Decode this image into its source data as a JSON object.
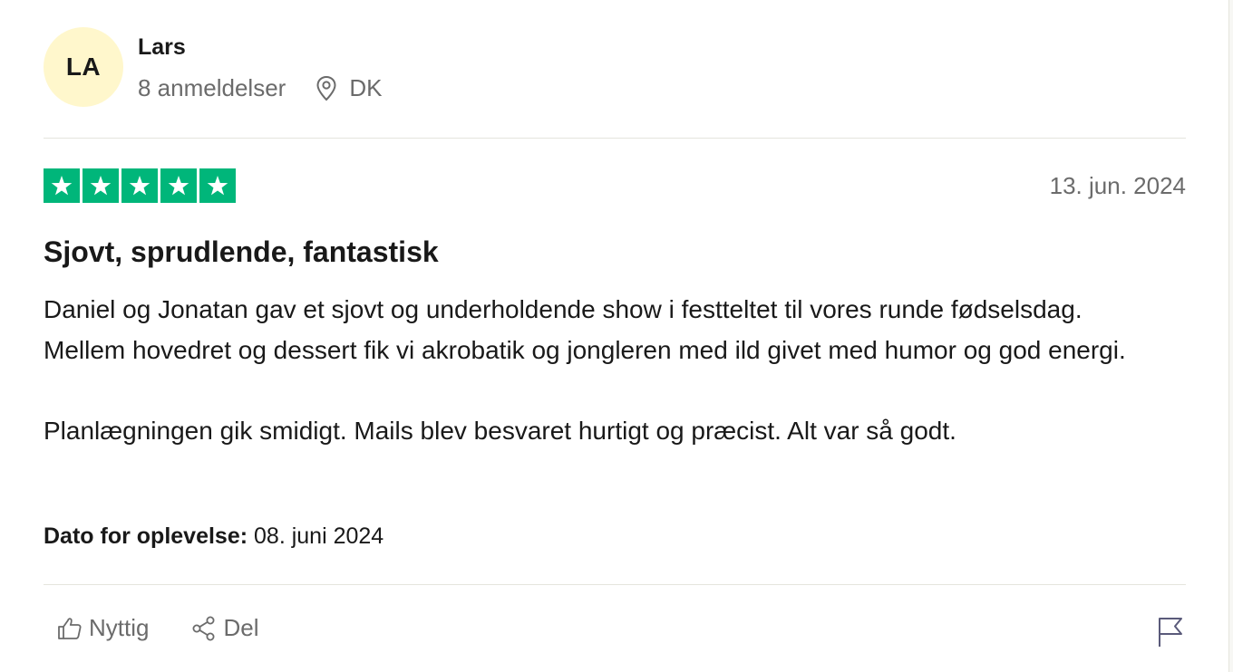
{
  "user": {
    "initials": "LA",
    "name": "Lars",
    "reviews_count": "8 anmeldelser",
    "country": "DK"
  },
  "review": {
    "rating": 5,
    "date": "13. jun. 2024",
    "title": "Sjovt, sprudlende, fantastisk",
    "paragraphs": [
      "Daniel og Jonatan gav et sjovt og underholdende show i festteltet til vores runde fødselsdag. Mellem hovedret og dessert fik vi akrobatik og jongleren med ild givet med humor og god energi.",
      "Planlægningen gik smidigt. Mails blev besvaret hurtigt og præcist. Alt var så godt."
    ],
    "experience_label": "Dato for oplevelse:",
    "experience_date": "08. juni 2024"
  },
  "actions": {
    "useful_label": "Nyttig",
    "share_label": "Del"
  },
  "colors": {
    "star_green": "#00b67a",
    "avatar_bg": "#fff7cc",
    "muted_text": "#6b6b6b",
    "divider": "#e5e5dd"
  },
  "icons": [
    "location-pin-icon",
    "star-icon",
    "thumbs-up-icon",
    "share-icon",
    "flag-icon"
  ]
}
